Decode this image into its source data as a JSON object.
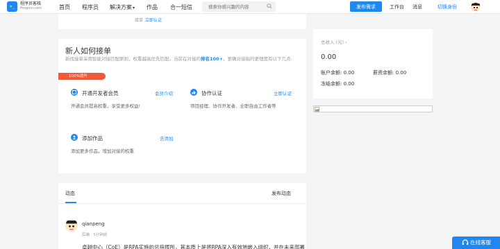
{
  "header": {
    "logo_glyph": ">_",
    "brand_name": "程序员客栈",
    "brand_domain": "Proginn.com",
    "nav": [
      {
        "label": "首页"
      },
      {
        "label": "程序员"
      },
      {
        "label": "解决方案"
      },
      {
        "label": "作品"
      },
      {
        "label": "合一短信"
      }
    ],
    "search_placeholder": "搜索你感兴趣的内容",
    "publish_label": "发布需求",
    "workbench_label": "工作台",
    "messages_label": "消息",
    "switch_identity_label": "切换身份"
  },
  "top_card": {
    "text": "接单",
    "link": "立即认证"
  },
  "how_to": {
    "title": "新人如何接单",
    "desc_prefix": "新找接单采用智能对接匹配原则，权重越高优先匹配。当前在对接的",
    "rank": "排名100+",
    "desc_suffix": "，更确对接指的更理度有以下几点:",
    "ribbon": "100%提升",
    "items": [
      {
        "name": "开通开发者会员",
        "link": "会员介绍",
        "desc": "开通会员提高权重，享受更多权益!",
        "icon": "member-icon"
      },
      {
        "name": "协作认证",
        "link": "立即认证",
        "desc": "项目经理、协作开发者、全职自由工作者等",
        "icon": "thumb-icon"
      },
      {
        "name": "添加作品",
        "link": "去添加",
        "desc": "添加更多作品，增加对接的权重",
        "icon": "add-work-icon"
      }
    ]
  },
  "feed": {
    "tab": "动态",
    "publish": "发布动态",
    "post": {
      "user": "qianpeng",
      "time": "后端 · 5分钟前",
      "text": "卓越中心（CoE）是RPA实施的总指挥所，其本质上是将RPA深入有效地嵌入组织，并在未来部署"
    }
  },
  "wallet": {
    "total_label": "总收入 (元)",
    "total_value": "0.00",
    "account_label": "账户余额:",
    "account_value": "0.00",
    "salary_label": "薪资余额:",
    "salary_value": "0.00",
    "frozen_label": "冻结余额:",
    "frozen_value": "0.00"
  },
  "online_service": "在线客服",
  "colors": {
    "accent": "#1e88f0",
    "ribbon": "#ee5a3a",
    "background": "#f3f4f6"
  }
}
